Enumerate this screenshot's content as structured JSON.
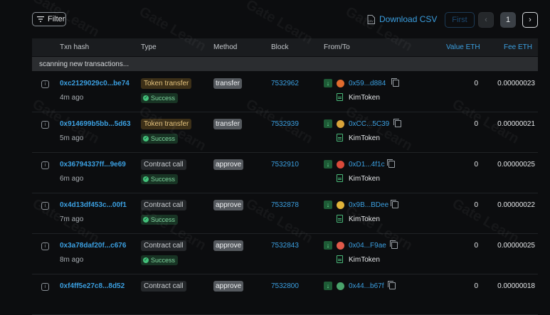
{
  "toolbar": {
    "filter_label": "Filter",
    "download_label": "Download CSV"
  },
  "pagination": {
    "first_label": "First",
    "prev_label": "‹",
    "current_page": "1",
    "next_label": "›"
  },
  "table": {
    "headers": {
      "txn_hash": "Txn hash",
      "type": "Type",
      "method": "Method",
      "block": "Block",
      "from_to": "From/To",
      "value": "Value ETH",
      "fee": "Fee ETH"
    },
    "scan_text": "scanning new transactions...",
    "rows": [
      {
        "hash": "0xc2129029c0...be74",
        "ago": "4m ago",
        "type": "Token transfer",
        "type_kind": "token",
        "status": "Success",
        "method": "transfer",
        "block": "7532962",
        "from": "0x59...d884",
        "to": "KimToken",
        "value": "0",
        "fee": "0.00000023",
        "avatar_color": "#e06b2e"
      },
      {
        "hash": "0x914699b5bb...5d63",
        "ago": "5m ago",
        "type": "Token transfer",
        "type_kind": "token",
        "status": "Success",
        "method": "transfer",
        "block": "7532939",
        "from": "0xCC...5C39",
        "to": "KimToken",
        "value": "0",
        "fee": "0.00000021",
        "avatar_color": "#d9a43a"
      },
      {
        "hash": "0x36794337ff...9e69",
        "ago": "6m ago",
        "type": "Contract call",
        "type_kind": "contract",
        "status": "Success",
        "method": "approve",
        "block": "7532910",
        "from": "0xD1...4f1c",
        "to": "KimToken",
        "value": "0",
        "fee": "0.00000025",
        "avatar_color": "#d94a3a"
      },
      {
        "hash": "0x4d13df453c...00f1",
        "ago": "7m ago",
        "type": "Contract call",
        "type_kind": "contract",
        "status": "Success",
        "method": "approve",
        "block": "7532878",
        "from": "0x9B...BDee",
        "to": "KimToken",
        "value": "0",
        "fee": "0.00000022",
        "avatar_color": "#e0b43a"
      },
      {
        "hash": "0x3a78daf20f...c676",
        "ago": "8m ago",
        "type": "Contract call",
        "type_kind": "contract",
        "status": "Success",
        "method": "approve",
        "block": "7532843",
        "from": "0x04...F9ae",
        "to": "KimToken",
        "value": "0",
        "fee": "0.00000025",
        "avatar_color": "#e05a4a"
      },
      {
        "hash": "0xf4ff5e27c8...8d52",
        "ago": "",
        "type": "Contract call",
        "type_kind": "contract",
        "status": "",
        "method": "approve",
        "block": "7532800",
        "from": "0x44...b67f",
        "to": "",
        "value": "0",
        "fee": "0.00000018",
        "avatar_color": "#4aa36b"
      }
    ]
  },
  "watermark_text": "Gate Learn"
}
